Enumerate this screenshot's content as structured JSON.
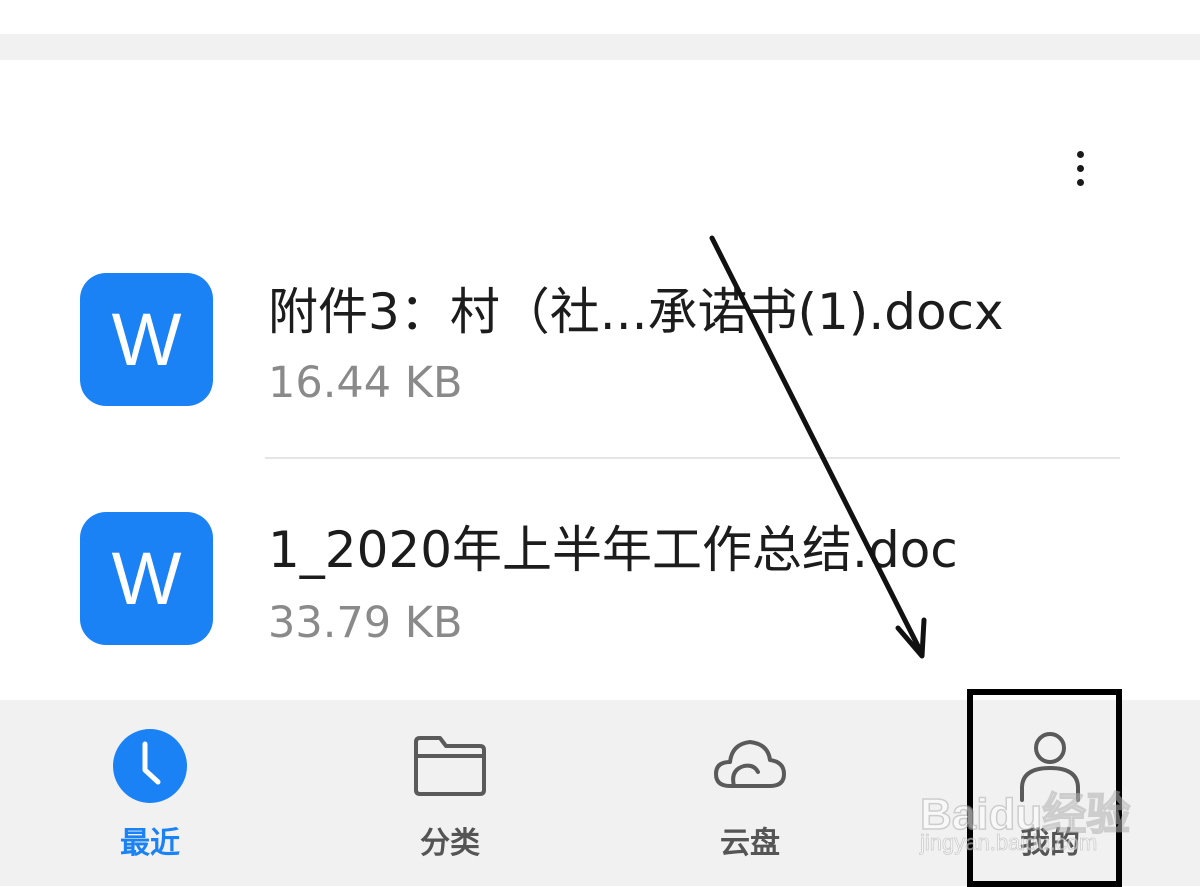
{
  "header": {
    "more_icon": "more-vertical-icon"
  },
  "files": [
    {
      "icon_letter": "W",
      "name": "附件3：村（社...承诺书(1).docx",
      "size": "16.44 KB"
    },
    {
      "icon_letter": "W",
      "name": "1_2020年上半年工作总结.doc",
      "size": "33.79 KB"
    }
  ],
  "bottom_nav": {
    "items": [
      {
        "label": "最近",
        "icon": "clock-icon",
        "active": true
      },
      {
        "label": "分类",
        "icon": "folder-icon",
        "active": false
      },
      {
        "label": "云盘",
        "icon": "cloud-icon",
        "active": false
      },
      {
        "label": "我的",
        "icon": "person-icon",
        "active": false
      }
    ]
  },
  "colors": {
    "accent": "#1a82f5",
    "nav_background": "#f1f1f1",
    "inactive_label": "#555555"
  },
  "watermark": {
    "line1": "Baidu经验",
    "line2": "jingyan.baidu.com"
  }
}
